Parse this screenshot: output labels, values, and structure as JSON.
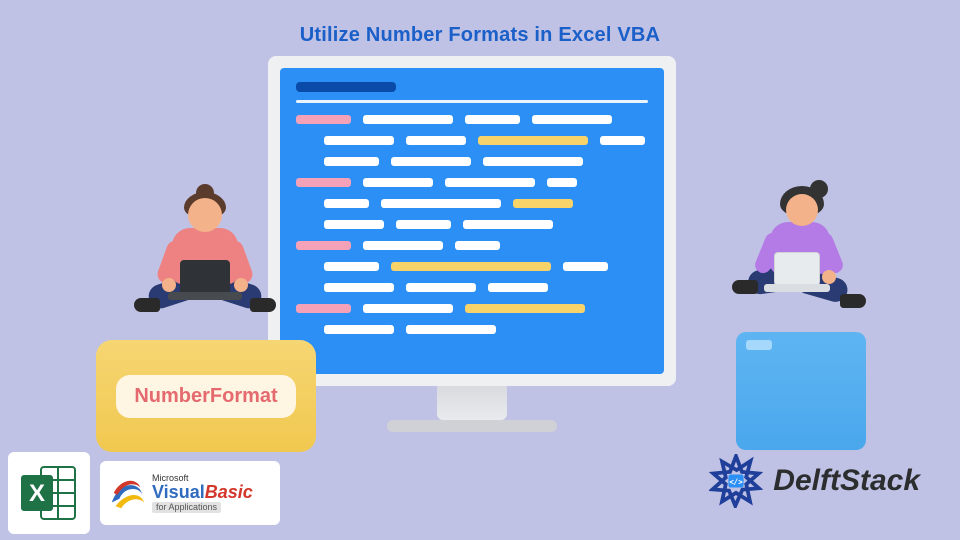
{
  "title": "Utilize Number Formats in Excel VBA",
  "label_box": "NumberFormat",
  "logos": {
    "delftstack": "DelftStack",
    "vb_microsoft": "Microsoft",
    "vb_visual": "Visual",
    "vb_basic": "Basic",
    "vb_for_apps": "for Applications",
    "excel_letter": "X"
  },
  "colors": {
    "background": "#c0c2e5",
    "title": "#1b5fc8",
    "screen": "#2b8ff6",
    "code_white": "#ffffff",
    "code_yellow": "#f8d36a",
    "code_pink": "#f5a2b9",
    "yellow_block": "#f1c84f",
    "blue_cube": "#4aa7ec",
    "nf_text": "#e56a6f",
    "excel_green": "#1f7246"
  },
  "illustration": {
    "left_person": {
      "hair": "#5b3b2c",
      "shirt": "#ee8181",
      "pants": "#2a3b73",
      "laptop": "#2f3338"
    },
    "right_person": {
      "hair": "#333333",
      "shirt": "#b47ae6",
      "pants": "#2a3b73",
      "laptop": "#e8ebee"
    }
  }
}
